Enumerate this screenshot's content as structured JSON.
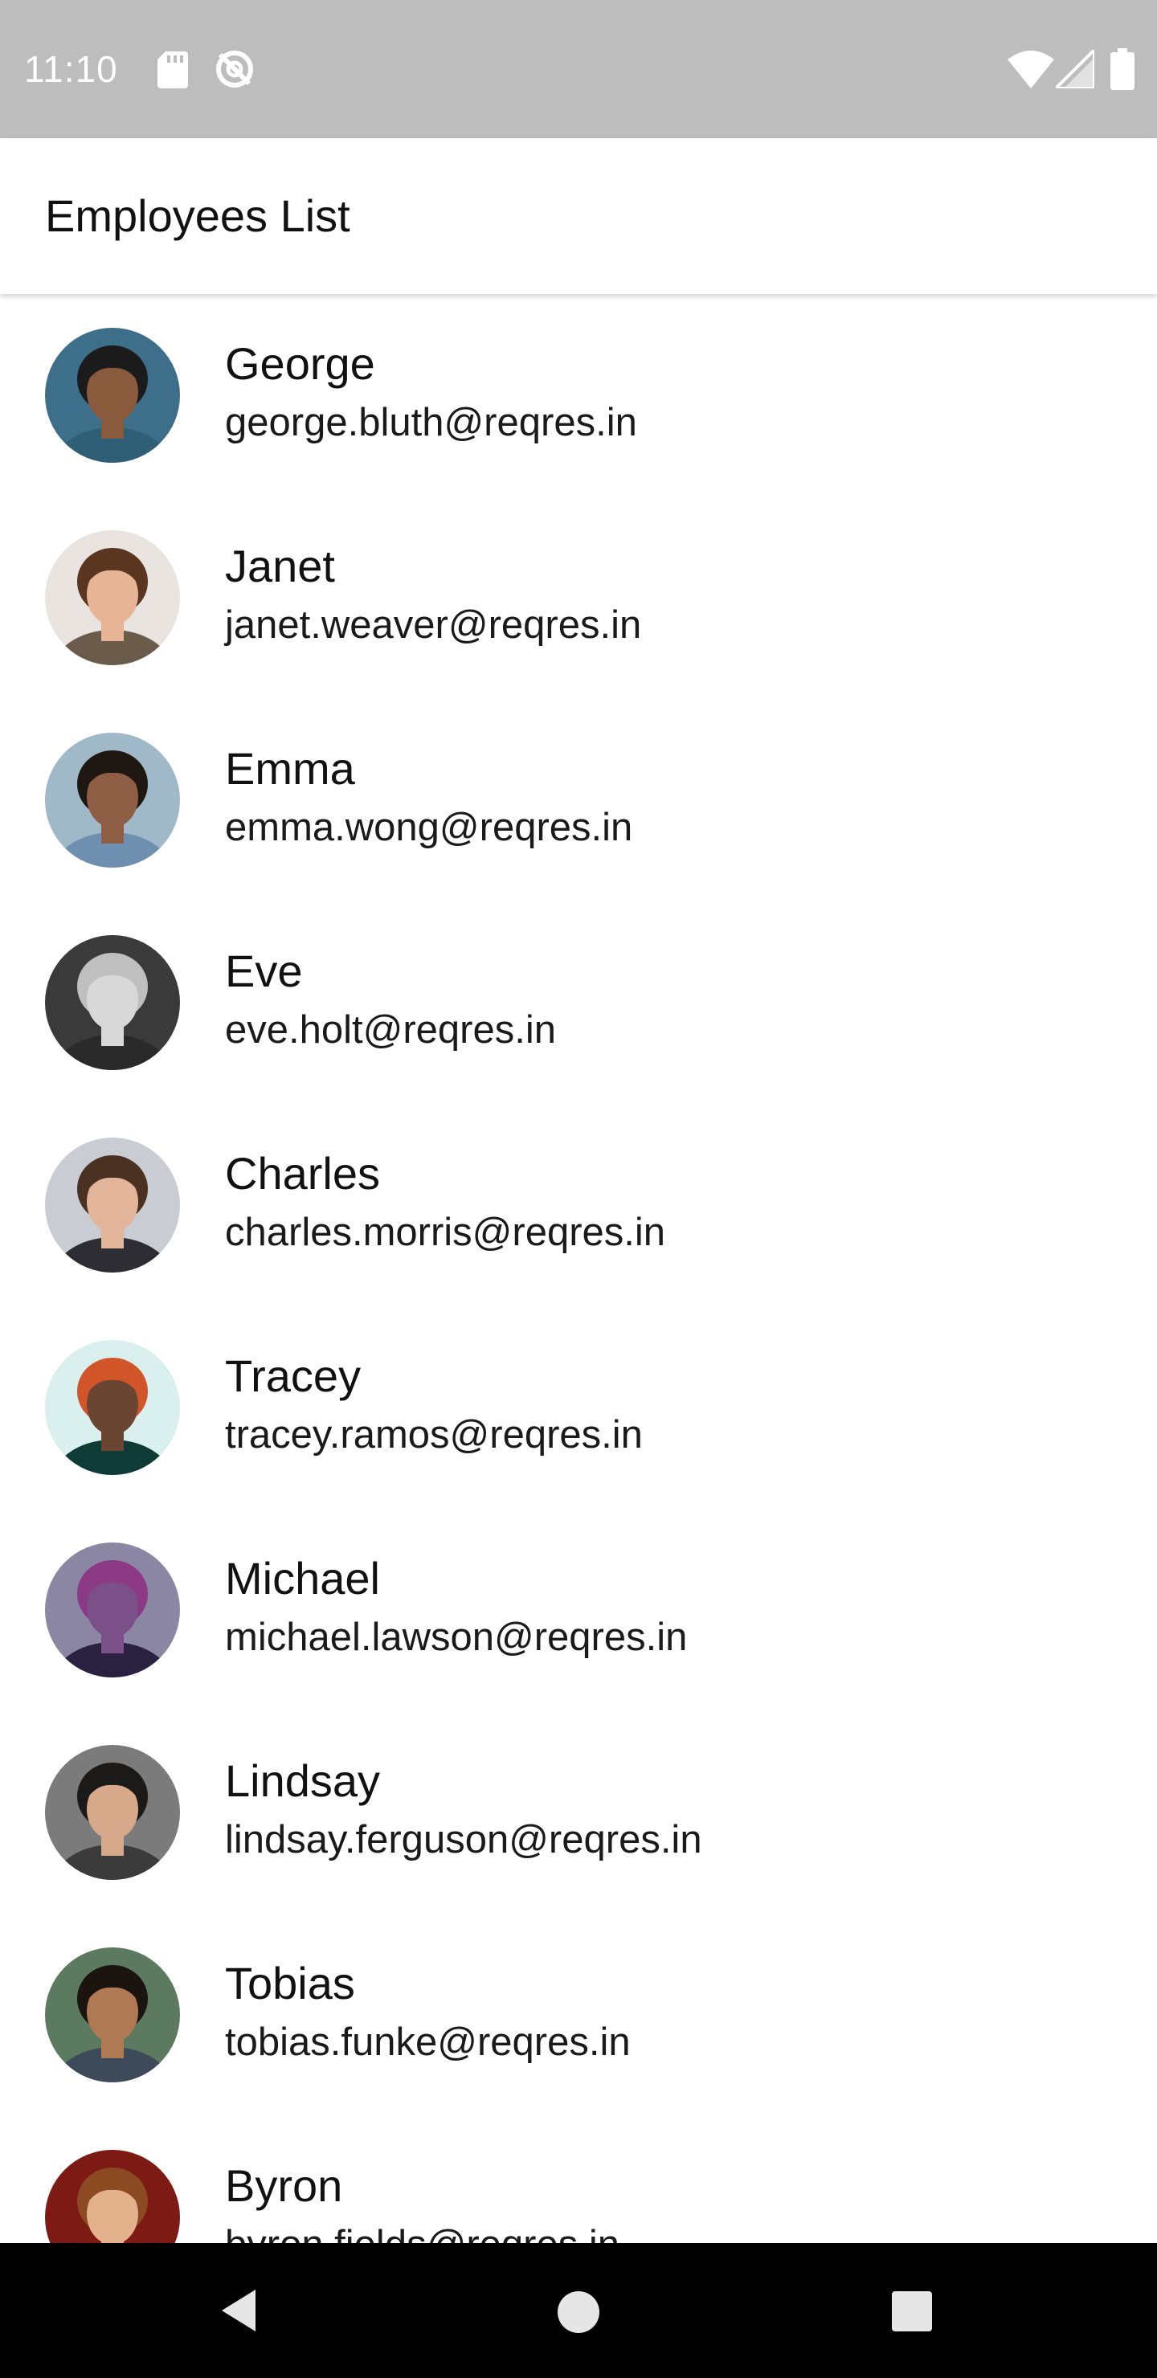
{
  "status_bar": {
    "time": "11:10",
    "icons": [
      "sd-card-icon",
      "sync-disabled-icon",
      "wifi-icon",
      "cell-signal-icon",
      "battery-icon"
    ],
    "background": "#bdbdbd"
  },
  "app_bar": {
    "title": "Employees List"
  },
  "employees": [
    {
      "name": "George",
      "email": "george.bluth@reqres.in",
      "avatar_bg": "#3d6f8a",
      "skin": "#8a5a3c",
      "hair": "#1b1b1b",
      "shirt": "#2f5f77"
    },
    {
      "name": "Janet",
      "email": "janet.weaver@reqres.in",
      "avatar_bg": "#e9e4df",
      "skin": "#e7b596",
      "hair": "#5a3620",
      "shirt": "#6b5b4b"
    },
    {
      "name": "Emma",
      "email": "emma.wong@reqres.in",
      "avatar_bg": "#9fb9c9",
      "skin": "#8e5e44",
      "hair": "#1f1712",
      "shirt": "#6f8fb0"
    },
    {
      "name": "Eve",
      "email": "eve.holt@reqres.in",
      "avatar_bg": "#3a3a3a",
      "skin": "#d8d8d8",
      "hair": "#bfbfbf",
      "shirt": "#2a2a2a"
    },
    {
      "name": "Charles",
      "email": "charles.morris@reqres.in",
      "avatar_bg": "#c9ccd2",
      "skin": "#e2b59a",
      "hair": "#4a3121",
      "shirt": "#2d2d33"
    },
    {
      "name": "Tracey",
      "email": "tracey.ramos@reqres.in",
      "avatar_bg": "#d9f0ef",
      "skin": "#6a4632",
      "hair": "#d2552a",
      "shirt": "#0f3b36"
    },
    {
      "name": "Michael",
      "email": "michael.lawson@reqres.in",
      "avatar_bg": "#8b86a3",
      "skin": "#7b4f87",
      "hair": "#8d3a86",
      "shirt": "#2a2040"
    },
    {
      "name": "Lindsay",
      "email": "lindsay.ferguson@reqres.in",
      "avatar_bg": "#7b7b7b",
      "skin": "#d6a98a",
      "hair": "#1c1a19",
      "shirt": "#3b3b3b"
    },
    {
      "name": "Tobias",
      "email": "tobias.funke@reqres.in",
      "avatar_bg": "#5c7a60",
      "skin": "#b07a55",
      "hair": "#1c140f",
      "shirt": "#3c4a5a"
    },
    {
      "name": "Byron",
      "email": "byron.fields@reqres.in",
      "avatar_bg": "#7e1a14",
      "skin": "#e3b18c",
      "hair": "#8c4a22",
      "shirt": "#5a1a14"
    }
  ],
  "nav_bar": {
    "buttons": [
      "back-icon",
      "home-icon",
      "recents-icon"
    ]
  }
}
